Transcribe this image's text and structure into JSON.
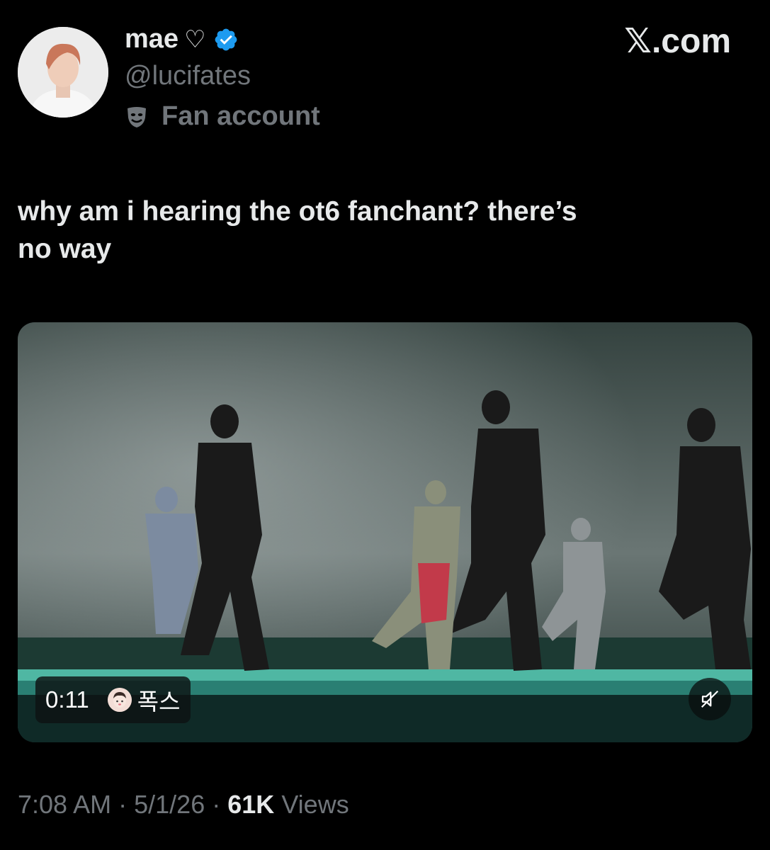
{
  "author": {
    "display_name": "mae",
    "name_suffix": "♡",
    "handle": "@lucifates",
    "account_label": "Fan account",
    "verified": true,
    "avatar_icon": "profile-photo"
  },
  "brand": {
    "logo_text": "𝕏.com"
  },
  "tweet": {
    "text_line1": "why am i hearing the ot6 fanchant? there’s",
    "text_line2": "no way"
  },
  "video": {
    "elapsed": "0:11",
    "uploader_label": "폭스",
    "mute_icon": "muted-speaker-icon"
  },
  "footer": {
    "time": "7:08 AM",
    "date": "5/1/26",
    "separator": "·",
    "views_count": "61K",
    "views_label": "Views"
  },
  "colors": {
    "background": "#000000",
    "text_primary": "#e7e9ea",
    "text_secondary": "#71767b",
    "verified_blue": "#1d9bf0"
  }
}
